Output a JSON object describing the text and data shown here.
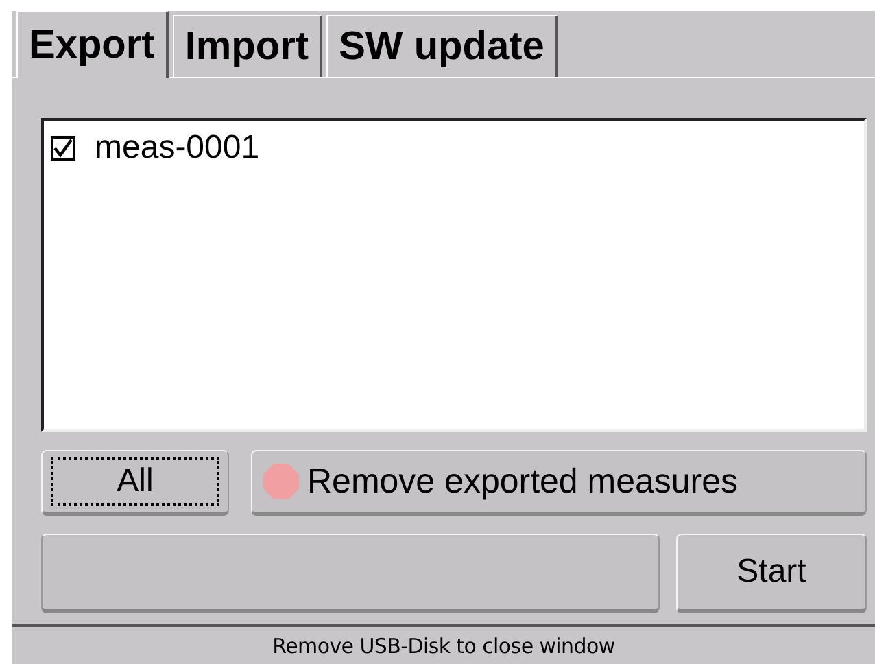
{
  "tabs": [
    {
      "label": "Export",
      "selected": true
    },
    {
      "label": "Import",
      "selected": false
    },
    {
      "label": "SW update",
      "selected": false
    }
  ],
  "measures": [
    {
      "name": "meas-0001",
      "checked": true
    }
  ],
  "all_button": {
    "label": "All",
    "focused": true
  },
  "remove_toggle": {
    "label": "Remove exported measures",
    "on": false
  },
  "progress": {
    "level": 0
  },
  "start_button": {
    "label": "Start"
  },
  "status_bar": "Remove USB-Disk to close window"
}
